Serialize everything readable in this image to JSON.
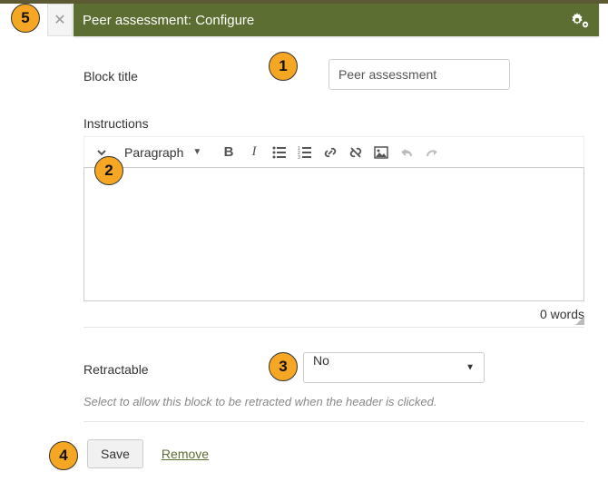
{
  "header": {
    "title": "Peer assessment: Configure"
  },
  "fields": {
    "block_title_label": "Block title",
    "block_title_value": "Peer assessment",
    "instructions_label": "Instructions",
    "retractable_label": "Retractable",
    "retractable_value": "No",
    "retractable_help": "Select to allow this block to be retracted when the header is clicked."
  },
  "editor": {
    "format_label": "Paragraph",
    "word_count": "0 words"
  },
  "buttons": {
    "save": "Save",
    "remove": "Remove"
  },
  "badges": {
    "b1": "1",
    "b2": "2",
    "b3": "3",
    "b4": "4",
    "b5": "5"
  }
}
